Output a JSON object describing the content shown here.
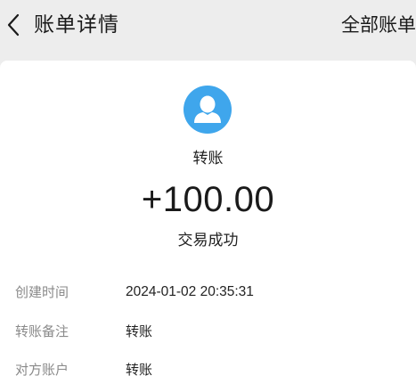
{
  "header": {
    "title": "账单详情",
    "all_bills_label": "全部账单"
  },
  "icons": {
    "back": "chevron-left-icon",
    "avatar": "user-avatar-icon"
  },
  "colors": {
    "background": "#ededed",
    "card": "#ffffff",
    "avatar_bg": "#3fa6ec",
    "label_text": "#8a8a8a"
  },
  "transaction": {
    "type": "转账",
    "amount": "+100.00",
    "status": "交易成功"
  },
  "details": [
    {
      "label": "创建时间",
      "value": "2024-01-02 20:35:31"
    },
    {
      "label": "转账备注",
      "value": "转账"
    },
    {
      "label": "对方账户",
      "value": "转账"
    }
  ]
}
